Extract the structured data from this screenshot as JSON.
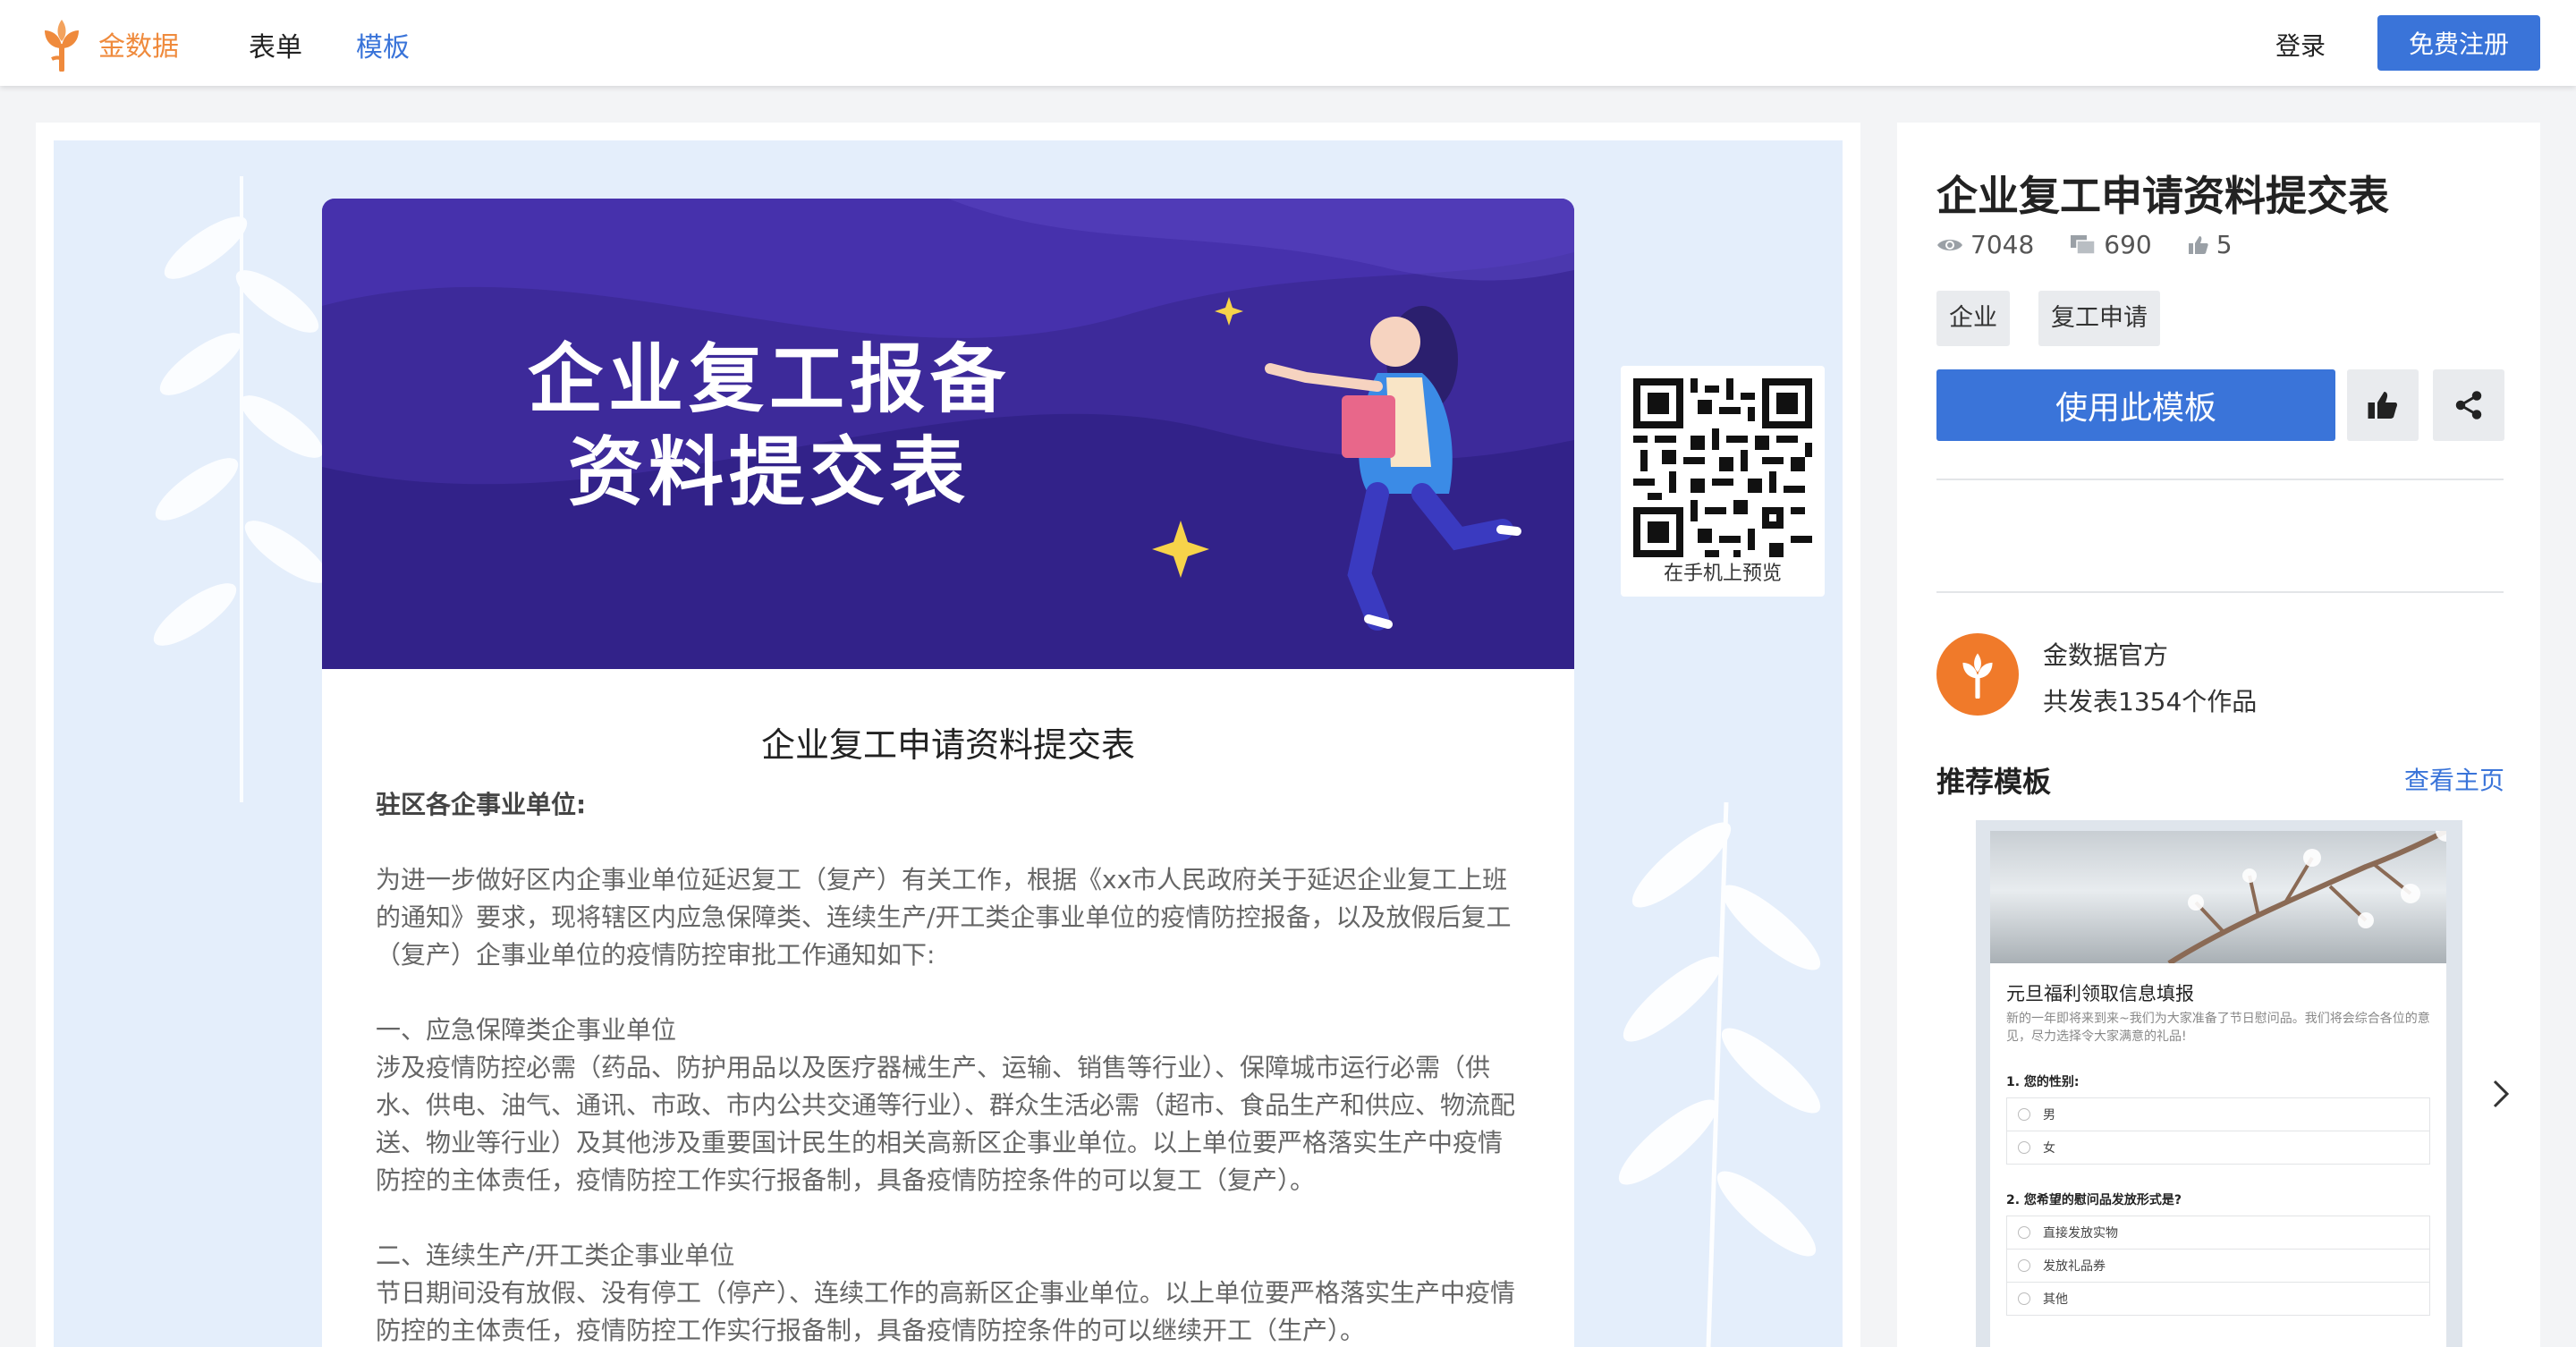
{
  "nav": {
    "logo_text": "金数据",
    "items": [
      {
        "label": "表单"
      },
      {
        "label": "模板"
      }
    ],
    "login": "登录",
    "signup": "免费注册"
  },
  "preview": {
    "banner_line1": "企业复工报备",
    "banner_line2": "资料提交表",
    "qr_caption": "在手机上预览",
    "form_title": "企业复工申请资料提交表",
    "addressee": "驻区各企事业单位:",
    "para1": "为进一步做好区内企事业单位延迟复工（复产）有关工作，根据《xx市人民政府关于延迟企业复工上班的通知》要求，现将辖区内应急保障类、连续生产/开工类企事业单位的疫情防控报备，以及放假后复工（复产）企事业单位的疫情防控审批工作通知如下:",
    "section1_title": "一、应急保障类企事业单位",
    "section1_body": "涉及疫情防控必需（药品、防护用品以及医疗器械生产、运输、销售等行业）、保障城市运行必需（供水、供电、油气、通讯、市政、市内公共交通等行业）、群众生活必需（超市、食品生产和供应、物流配送、物业等行业）及其他涉及重要国计民生的相关高新区企事业单位。以上单位要严格落实生产中疫情防控的主体责任，疫情防控工作实行报备制，具备疫情防控条件的可以复工（复产）。",
    "section2_title": "二、连续生产/开工类企事业单位",
    "section2_body": "节日期间没有放假、没有停工（停产）、连续工作的高新区企事业单位。以上单位要严格落实生产中疫情防控的主体责任，疫情防控工作实行报备制，具备疫情防控条件的可以继续开工（生产）。"
  },
  "side": {
    "title": "企业复工申请资料提交表",
    "views": "7048",
    "uses": "690",
    "likes": "5",
    "tags": [
      "企业",
      "复工申请"
    ],
    "use_button": "使用此模板",
    "author_name": "金数据官方",
    "author_count": "共发表1354个作品",
    "recommend_title": "推荐模板",
    "recommend_link": "查看主页",
    "rec_card": {
      "title": "元旦福利领取信息填报",
      "desc": "新的一年即将来到来~我们为大家准备了节日慰问品。我们将会综合各位的意见，尽力选择令大家满意的礼品!",
      "q1": "1. 您的性别:",
      "q1_options": [
        "男",
        "女"
      ],
      "q2": "2. 您希望的慰问品发放形式是?",
      "q2_options": [
        "直接发放实物",
        "发放礼品券",
        "其他"
      ]
    }
  },
  "colors": {
    "brand_orange": "#ef8a3c",
    "primary_blue": "#3a74d9",
    "banner_purple": "#3d2a9a"
  }
}
